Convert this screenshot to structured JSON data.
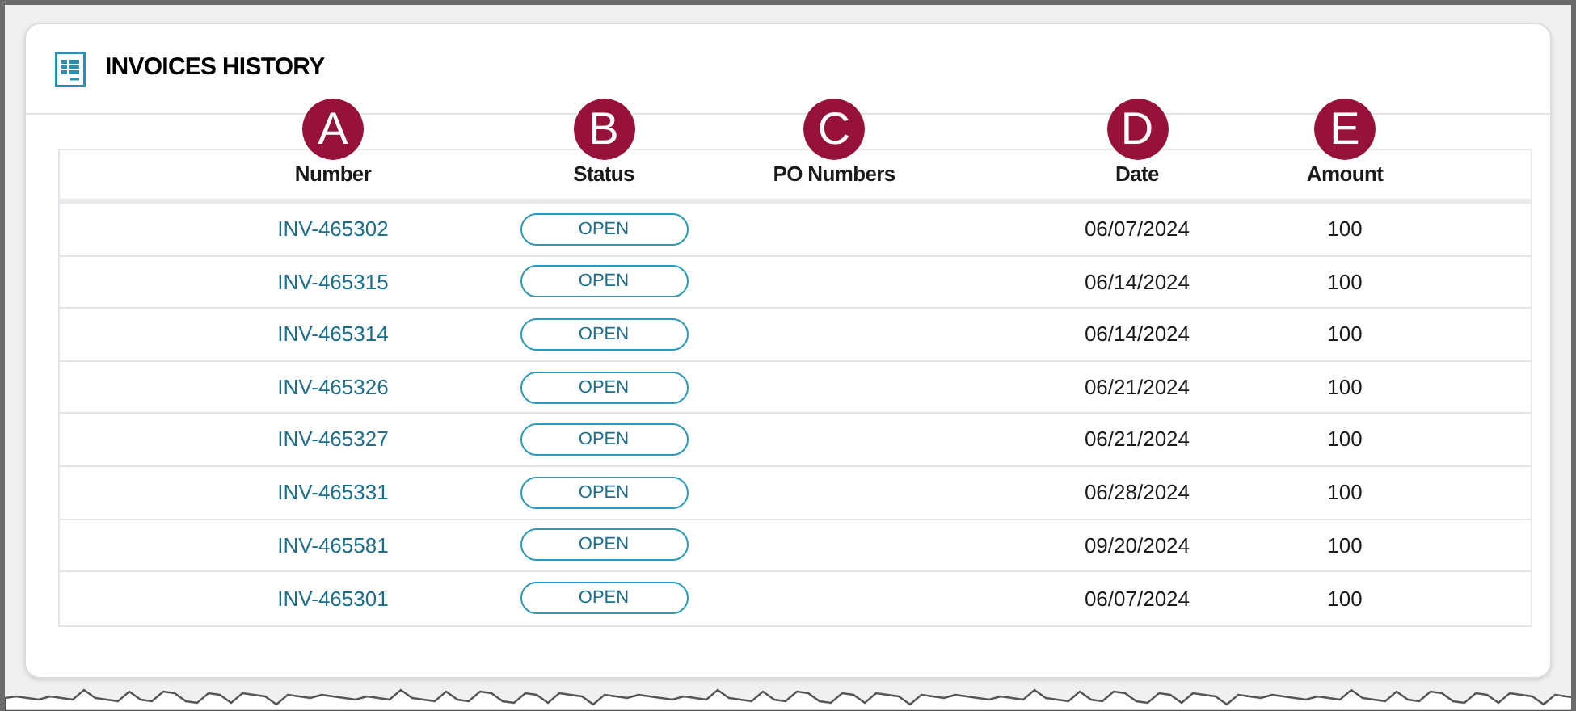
{
  "panel": {
    "title": "INVOICES HISTORY"
  },
  "table": {
    "columns": [
      {
        "label": "Number",
        "marker": "A"
      },
      {
        "label": "Status",
        "marker": "B"
      },
      {
        "label": "PO Numbers",
        "marker": "C"
      },
      {
        "label": "Date",
        "marker": "D"
      },
      {
        "label": "Amount",
        "marker": "E"
      }
    ],
    "rows": [
      {
        "number": "INV-465302",
        "status": "OPEN",
        "date": "06/07/2024",
        "amount": "100"
      },
      {
        "number": "INV-465315",
        "status": "OPEN",
        "date": "06/14/2024",
        "amount": "100"
      },
      {
        "number": "INV-465314",
        "status": "OPEN",
        "date": "06/14/2024",
        "amount": "100"
      },
      {
        "number": "INV-465326",
        "status": "OPEN",
        "date": "06/21/2024",
        "amount": "100"
      },
      {
        "number": "INV-465327",
        "status": "OPEN",
        "date": "06/21/2024",
        "amount": "100"
      },
      {
        "number": "INV-465331",
        "status": "OPEN",
        "date": "06/28/2024",
        "amount": "100"
      },
      {
        "number": "INV-465581",
        "status": "OPEN",
        "date": "09/20/2024",
        "amount": "100"
      },
      {
        "number": "INV-465301",
        "status": "OPEN",
        "date": "06/07/2024",
        "amount": "100"
      }
    ]
  }
}
